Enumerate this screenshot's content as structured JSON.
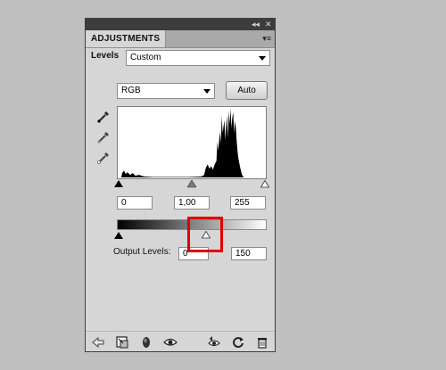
{
  "window": {
    "tab_title": "ADJUSTMENTS",
    "collapse_glyph": "◂◂",
    "close_glyph": "✕",
    "menu_glyph": "▾≡"
  },
  "levels": {
    "label": "Levels",
    "preset_value": "Custom",
    "channel_value": "RGB",
    "auto_label": "Auto"
  },
  "input_levels": {
    "black": "0",
    "gamma": "1,00",
    "white": "255"
  },
  "output_levels": {
    "label": "Output Levels:",
    "black": "0",
    "white": "150"
  },
  "icons": {
    "eyedroppers": [
      "black-point-eyedropper-icon",
      "gray-point-eyedropper-icon",
      "white-point-eyedropper-icon"
    ],
    "bottom": [
      "back-arrow-icon",
      "expand-view-icon",
      "clip-layer-icon",
      "visibility-eye-icon",
      "view-previous-icon",
      "reset-icon",
      "trash-icon"
    ]
  },
  "colors": {
    "panel_bg": "#d6d6d6",
    "highlight": "#e00000",
    "canvas_bg": "#c0c0c0"
  }
}
